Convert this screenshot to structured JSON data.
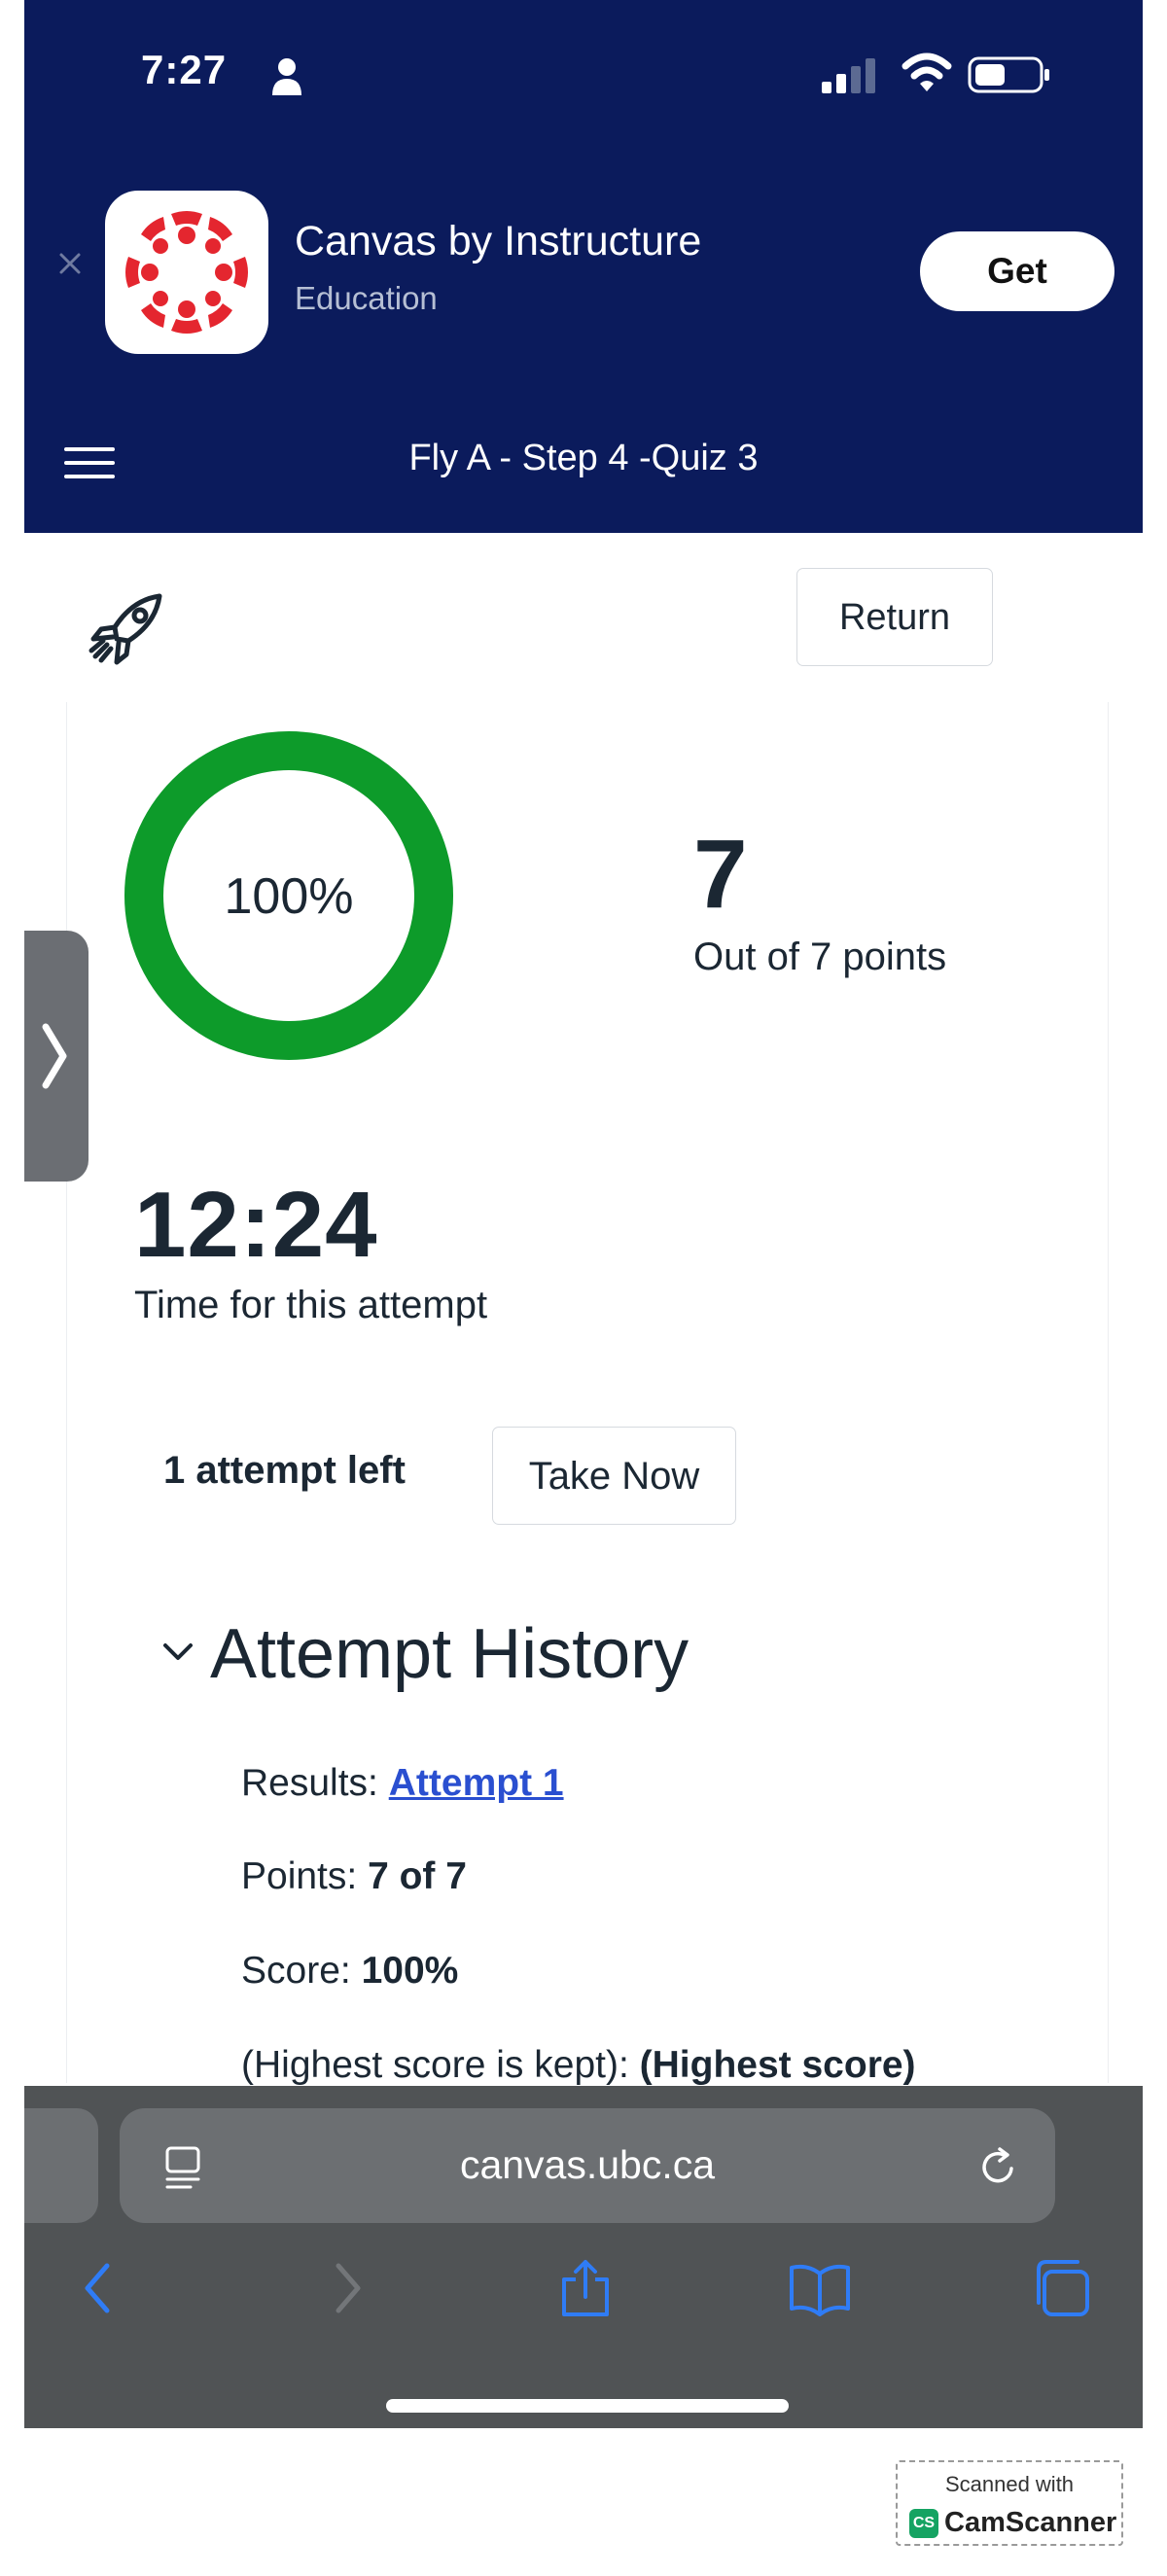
{
  "status_bar": {
    "time": "7:27"
  },
  "app_banner": {
    "app_name": "Canvas by Instructure",
    "category": "Education",
    "get_label": "Get"
  },
  "header": {
    "course_title": "Fly A - Step 4 -Quiz 3"
  },
  "toolbar": {
    "return_label": "Return"
  },
  "result": {
    "percent_label": "100%",
    "percent_value": 1.0,
    "ring_color": "#0d9b2a",
    "score": "7",
    "score_caption": "Out of 7 points",
    "time": "12:24",
    "time_caption": "Time for this attempt"
  },
  "attempts": {
    "left_label": "1 attempt left",
    "take_now_label": "Take Now"
  },
  "history": {
    "title": "Attempt History",
    "results_label": "Results:",
    "results_link": "Attempt 1",
    "points_label": "Points:",
    "points_value": "7 of 7",
    "score_label": "Score:",
    "score_value": "100%",
    "policy_label": "(Highest score is kept):",
    "policy_value": "(Highest score)"
  },
  "browser": {
    "url": "canvas.ubc.ca",
    "nav_color": "#2f7cf6"
  },
  "watermark": {
    "line1": "Scanned with",
    "badge": "CS",
    "line2": "CamScanner"
  }
}
